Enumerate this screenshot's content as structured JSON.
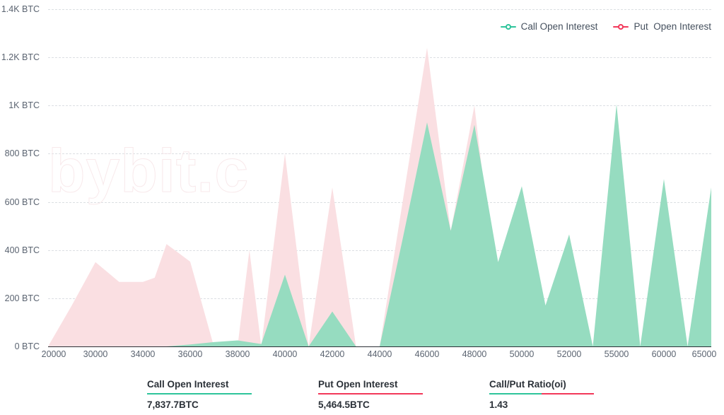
{
  "legend": {
    "items": [
      {
        "label": "Call Open Interest",
        "color": "#2ec49b",
        "icon": "line-marker-icon"
      },
      {
        "label": "Put  Open Interest",
        "color": "#f2385a",
        "icon": "line-marker-icon"
      }
    ]
  },
  "watermark": {
    "text": "bybit.c"
  },
  "colors": {
    "call_fill": "#96dcc0",
    "put_fill": "#fadfe2",
    "call_line": "#2ec49b",
    "put_line": "#f2385a",
    "grid": "#dcdfe3",
    "axis": "#2b2f36",
    "tick_text": "#5b6471"
  },
  "footer": {
    "stats": [
      {
        "title": "Call Open Interest",
        "value": "7,837.7BTC",
        "rule": [
          "#2ec49b"
        ]
      },
      {
        "title": "Put Open Interest",
        "value": "5,464.5BTC",
        "rule": [
          "#f2385a"
        ]
      },
      {
        "title": "Call/Put Ratio(oi)",
        "value": "1.43",
        "rule": [
          "#2ec49b",
          "#f2385a"
        ]
      }
    ]
  },
  "chart_data": {
    "type": "area",
    "title": "",
    "xlabel": "",
    "ylabel": "",
    "ylim": [
      0,
      1400
    ],
    "grid": true,
    "legend_position": "top-right",
    "yticks": [
      0,
      200,
      400,
      600,
      800,
      1000,
      1200,
      1400
    ],
    "ytick_labels": [
      "0 BTC",
      "200 BTC",
      "400 BTC",
      "600 BTC",
      "800 BTC",
      "1K BTC",
      "1.2K BTC",
      "1.4K BTC"
    ],
    "categories": [
      "20000",
      "30000",
      "34000",
      "36000",
      "38000",
      "40000",
      "42000",
      "44000",
      "46000",
      "48000",
      "50000",
      "52000",
      "55000",
      "60000",
      "65000"
    ],
    "x": [
      20000,
      30000,
      34000,
      36000,
      38000,
      40000,
      42000,
      44000,
      46000,
      48000,
      50000,
      52000,
      55000,
      60000,
      65000
    ],
    "series": [
      {
        "name": "Call Open Interest",
        "color": "#2ec49b",
        "fill": "#96dcc0",
        "values": [
          0,
          0,
          0,
          8,
          25,
          298,
          145,
          0,
          930,
          920,
          665,
          465,
          1005,
          695,
          660
        ]
      },
      {
        "name": "Put  Open Interest",
        "color": "#f2385a",
        "fill": "#fadfe2",
        "values": [
          0,
          350,
          268,
          352,
          0,
          800,
          660,
          0,
          1240,
          1000,
          0,
          0,
          0,
          0,
          0
        ]
      }
    ],
    "dense_points": {
      "note": "Underlying curve sampled at finer strike resolution than the labelled ticks; positions are fractional category indices.",
      "call": [
        [
          0,
          0
        ],
        [
          1,
          0
        ],
        [
          2,
          0
        ],
        [
          2.5,
          0
        ],
        [
          3,
          8
        ],
        [
          3.5,
          18
        ],
        [
          4,
          25
        ],
        [
          4.5,
          10
        ],
        [
          5,
          298
        ],
        [
          5.5,
          0
        ],
        [
          6,
          145
        ],
        [
          6.5,
          0
        ],
        [
          7,
          0
        ],
        [
          7.5,
          460
        ],
        [
          8,
          930
        ],
        [
          8.5,
          480
        ],
        [
          9,
          920
        ],
        [
          9.5,
          350
        ],
        [
          10,
          665
        ],
        [
          10.5,
          170
        ],
        [
          11,
          465
        ],
        [
          11.5,
          0
        ],
        [
          12,
          1005
        ],
        [
          12.5,
          0
        ],
        [
          13,
          695
        ],
        [
          13.5,
          0
        ],
        [
          14,
          660
        ]
      ],
      "put": [
        [
          0,
          0
        ],
        [
          0.5,
          170
        ],
        [
          1,
          350
        ],
        [
          1.5,
          268
        ],
        [
          2,
          268
        ],
        [
          2.25,
          285
        ],
        [
          2.5,
          425
        ],
        [
          3,
          352
        ],
        [
          3.5,
          0
        ],
        [
          4,
          0
        ],
        [
          4.25,
          400
        ],
        [
          4.5,
          0
        ],
        [
          5,
          800
        ],
        [
          5.5,
          0
        ],
        [
          6,
          660
        ],
        [
          6.5,
          0
        ],
        [
          7,
          0
        ],
        [
          8,
          1240
        ],
        [
          8.5,
          480
        ],
        [
          9,
          1000
        ],
        [
          9.6,
          0
        ],
        [
          10,
          0
        ],
        [
          14,
          0
        ]
      ]
    }
  }
}
